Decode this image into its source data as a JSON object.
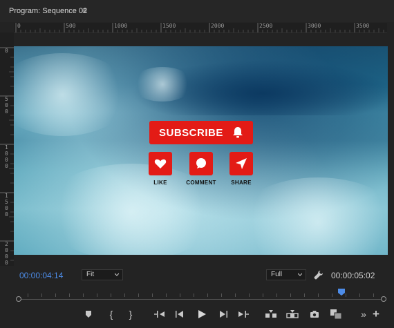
{
  "header": {
    "title": "Program: Sequence 02",
    "menu_icon": "hamburger-menu-icon"
  },
  "ruler": {
    "top_labels": [
      "0",
      "500",
      "1000",
      "1500",
      "2000",
      "2500",
      "3000",
      "3500"
    ],
    "left_labels": [
      "0",
      "500",
      "1000",
      "1500",
      "2000"
    ]
  },
  "overlay": {
    "subscribe_label": "SUBSCRIBE",
    "like_label": "LIKE",
    "comment_label": "COMMENT",
    "share_label": "SHARE",
    "accent": "#e31b16"
  },
  "controls": {
    "current_timecode": "00:00:04:14",
    "duration_timecode": "00:00:05:02",
    "zoom_select": "Fit",
    "resolution_select": "Full",
    "timecode_color": "#4d8ce8",
    "playhead_color": "#4d8ce8",
    "transport": {
      "mark_in": "{",
      "mark_out": "}",
      "more": "»",
      "add": "+"
    }
  }
}
